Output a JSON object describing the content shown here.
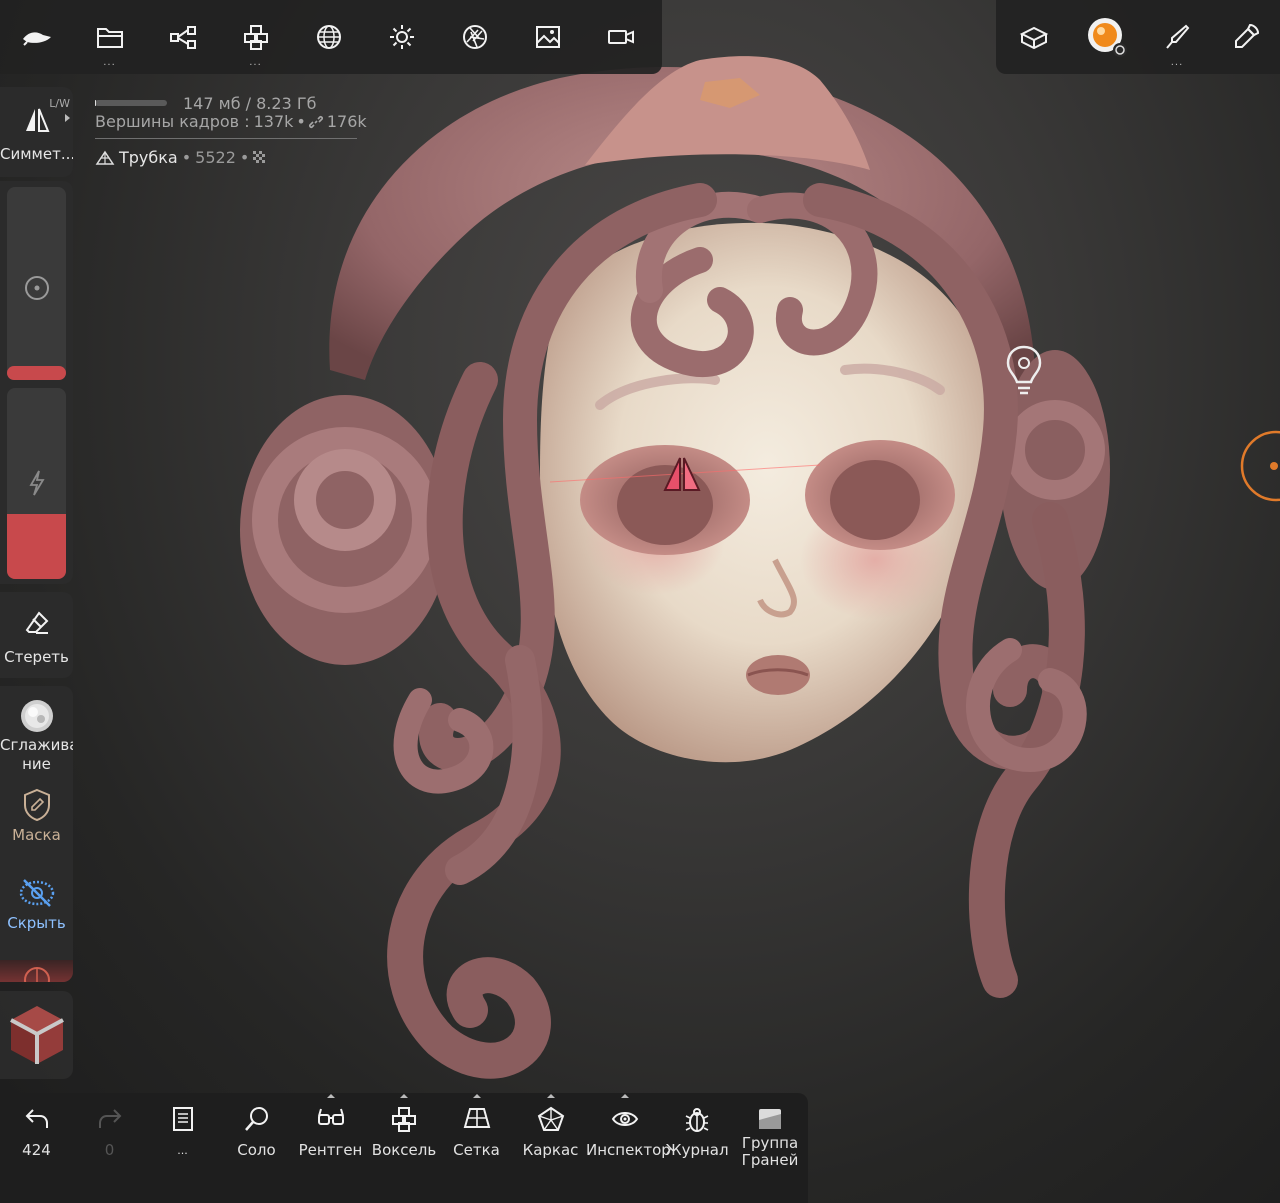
{
  "toolbar_top_left": {
    "buttons": [
      {
        "name": "logo-menu",
        "dots": ""
      },
      {
        "name": "files",
        "dots": "..."
      },
      {
        "name": "scene",
        "dots": ""
      },
      {
        "name": "multires",
        "dots": "..."
      },
      {
        "name": "topology",
        "dots": ""
      },
      {
        "name": "lighting",
        "dots": ""
      },
      {
        "name": "camera-lens",
        "dots": ""
      },
      {
        "name": "background",
        "dots": ""
      },
      {
        "name": "video",
        "dots": ""
      }
    ]
  },
  "toolbar_top_right": {
    "paint_dots": "..."
  },
  "stats": {
    "memory_text": "147 мб / 8.23 Гб",
    "memory_fraction": 0.02,
    "vertices_label": "Вершины кадров :",
    "vertices_value": "137k",
    "link_value": "176k",
    "object_name": "Трубка",
    "object_count": "5522"
  },
  "left_panel": {
    "symmetry_tag": "L/W",
    "symmetry_label": "Симмет...",
    "radius_fraction": 0.07,
    "strength_fraction": 0.34,
    "erase_label": "Стереть",
    "smooth_label_1": "Сглажива",
    "smooth_label_2": "ние",
    "mask_label": "Маска",
    "hide_label": "Скрыть"
  },
  "bottom_bar": {
    "undo_count": "424",
    "redo_count": "0",
    "history_dots": "...",
    "solo": "Соло",
    "xray": "Рентген",
    "voxel": "Воксель",
    "grid": "Сетка",
    "wireframe": "Каркас",
    "inspector": "Инспектор",
    "journal": "Журнал",
    "facegroup_1": "Группа",
    "facegroup_2": "Граней"
  },
  "colors": {
    "accent_red": "#c8494c",
    "gizmo_orange": "#e07a2a",
    "clay_base": "#a9787a",
    "skin": "#e9ddcf"
  }
}
